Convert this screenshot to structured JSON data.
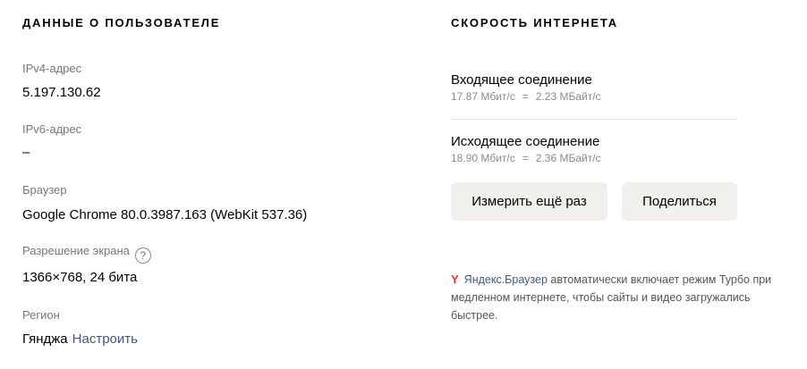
{
  "user": {
    "title": "ДАННЫЕ О ПОЛЬЗОВАТЕЛЕ",
    "ipv4": {
      "label": "IPv4-адрес",
      "value": "5.197.130.62"
    },
    "ipv6": {
      "label": "IPv6-адрес",
      "value": "–"
    },
    "browser": {
      "label": "Браузер",
      "value": "Google Chrome 80.0.3987.163 (WebKit 537.36)"
    },
    "resolution": {
      "label": "Разрешение экрана",
      "help": "?",
      "value": "1366×768, 24 бита"
    },
    "region": {
      "label": "Регион",
      "value": "Гянджа",
      "configure_link": "Настроить"
    }
  },
  "speed": {
    "title": "СКОРОСТЬ ИНТЕРНЕТА",
    "incoming": {
      "label": "Входящее соединение",
      "mbit": "17.87 Мбит/с",
      "eq": "=",
      "mbyte": "2.23 МБайт/с"
    },
    "outgoing": {
      "label": "Исходящее соединение",
      "mbit": "18.90 Мбит/с",
      "eq": "=",
      "mbyte": "2.36 МБайт/с"
    },
    "measure_button": "Измерить ещё раз",
    "share_button": "Поделиться"
  },
  "promo": {
    "icon": "yandex-browser-icon",
    "icon_glyph": "Y",
    "brand": "Яндекс.Браузер",
    "text": " автоматически включает режим Турбо при медленном интернете, чтобы сайты и видео загружались быстрее."
  }
}
